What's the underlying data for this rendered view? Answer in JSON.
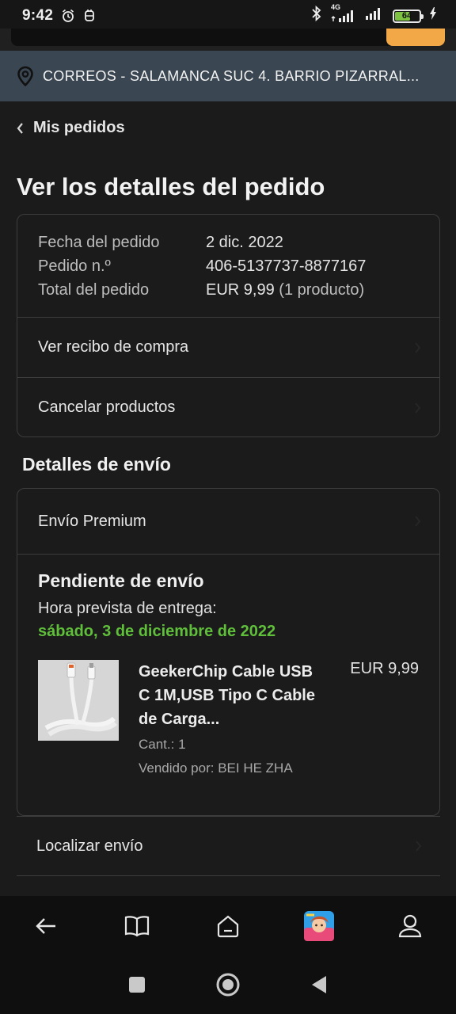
{
  "status_bar": {
    "time": "9:42",
    "network": "4G",
    "battery": "64",
    "battery_level": 0.64
  },
  "location_bar": {
    "text": "CORREOS - SALAMANCA SUC 4. BARRIO PIZARRAL..."
  },
  "nav": {
    "back_label": "Mis pedidos"
  },
  "page_title": "Ver los detalles del pedido",
  "order_summary": {
    "date_label": "Fecha del pedido",
    "date_value": "2 dic. 2022",
    "number_label": "Pedido n.º",
    "number_value": "406-5137737-8877167",
    "total_label": "Total del pedido",
    "total_value": "EUR 9,99",
    "total_note": "(1 producto)",
    "receipt_link": "Ver recibo de compra",
    "cancel_link": "Cancelar productos"
  },
  "shipping": {
    "section_title": "Detalles de envío",
    "method": "Envío Premium",
    "status": "Pendiente de envío",
    "eta_label": "Hora prevista de entrega:",
    "eta_date": "sábado, 3 de diciembre de 2022",
    "product": {
      "name": "GeekerChip Cable USB C 1M,USB Tipo C Cable de Carga...",
      "price": "EUR 9,99",
      "quantity": "Cant.: 1",
      "seller": "Vendido por: BEI HE ZHA"
    },
    "track_link": "Localizar envío"
  },
  "bottom_nav": {
    "items": [
      "back-arrow-icon",
      "book-icon",
      "home-icon",
      "game-app-icon",
      "account-icon"
    ]
  },
  "colors": {
    "accent_green": "#5fbf3b",
    "search_button": "#f3a847",
    "location_bar": "#3a4651"
  }
}
